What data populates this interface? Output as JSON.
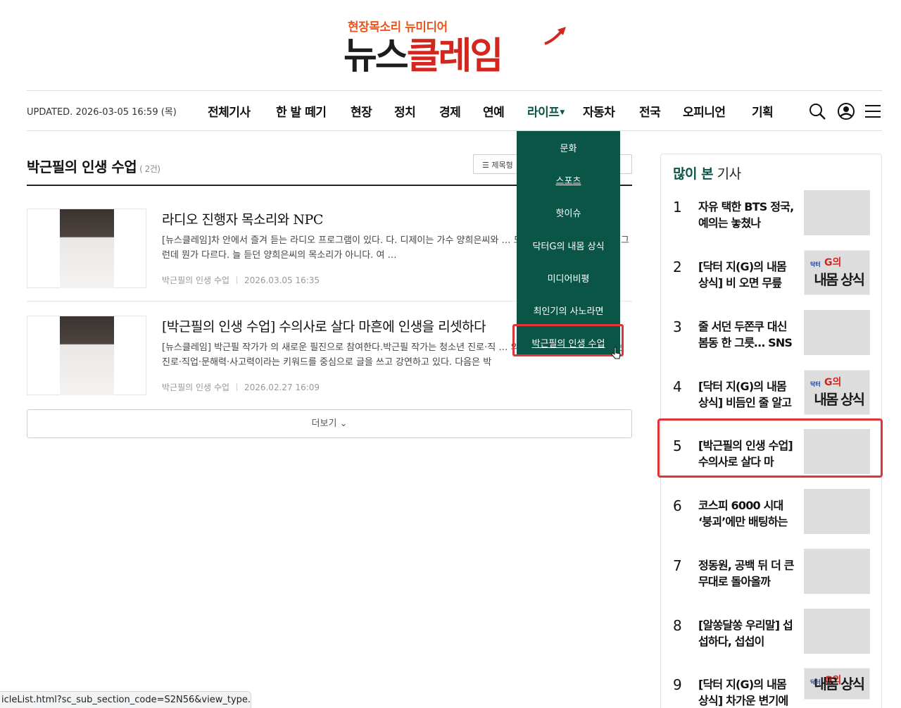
{
  "logo": {
    "tagline": "현장목소리 뉴미디어",
    "name_part1": "뉴스",
    "name_part2": "클레임"
  },
  "header": {
    "updated": "UPDATED. 2026-03-05 16:59 (목)",
    "nav": [
      "전체기사",
      "한 발 떼기",
      "현장",
      "정치",
      "경제",
      "연예",
      "라이프",
      "자동차",
      "전국",
      "오피니언",
      "기획"
    ],
    "icons": [
      "search-icon",
      "user-icon",
      "menu-icon"
    ]
  },
  "dropdown": {
    "items": [
      "문화",
      "스포츠",
      "핫이슈",
      "닥터G의 내몸 상식",
      "미디어비평",
      "최인기의 사노라면",
      "박근필의 인생 수업"
    ]
  },
  "section": {
    "title": "박근필의 인생 수업",
    "count": "( 2건)",
    "view_label": "제목형"
  },
  "articles": [
    {
      "title": "라디오 진행자 목소리와 NPC",
      "summary": "[뉴스클레임]차 안에서 즐겨 듣는 라디오 프로그램이 있다. 다. 디제이는 가수 양희은씨와 … 도 어김없이 라디오를 켰다. 그런데 뭔가 다르다. 늘 듣던 양희은씨의 목소리가 아니다. 여 …",
      "section": "박근필의 인생 수업",
      "date": "2026.03.05 16:35"
    },
    {
      "title": "[박근필의 인생 수업] 수의사로 살다 마흔에 인생을 리셋하다",
      "summary": "[뉴스클레임] 박근필 작가가 의 새로운 필진으로 참여한다.박근필 작가는 청소년 진로·직 … 의 저서를 출간했고, 최근에는 진로·직업·문해력·사고력이라는 키워드를 중심으로 글을 쓰고 강연하고 있다. 다음은 박",
      "section": "박근필의 인생 수업",
      "date": "2026.02.27 16:09"
    }
  ],
  "more": "더보기",
  "popular": {
    "title_hl": "많이 본",
    "title_rest": "기사",
    "items": [
      {
        "num": "1",
        "text": "자유 택한 BTS 정국, 예의는 놓쳤나",
        "thumb": "person"
      },
      {
        "num": "2",
        "text": "[닥터 지(G)의 내몸 상식] 비 오면 무릎",
        "thumb": "comic"
      },
      {
        "num": "3",
        "text": "줄 서던 두쫀쿠 대신 봄동 한 그릇… SNS",
        "thumb": "food"
      },
      {
        "num": "4",
        "text": "[닥터 지(G)의 내몸 상식] 비듬인 줄 알고",
        "thumb": "comic"
      },
      {
        "num": "5",
        "text": "[박근필의 인생 수업] 수의사로 살다 마",
        "thumb": "doctor"
      },
      {
        "num": "6",
        "text": "코스피 6000 시대 ‘붕괴’에만 배팅하는",
        "thumb": "market"
      },
      {
        "num": "7",
        "text": "정동원, 공백 뒤 더 큰 무대로 돌아올까",
        "thumb": "man"
      },
      {
        "num": "8",
        "text": "[알쏭달쏭 우리말] 섭섭하다, 섭섭이",
        "thumb": "dark"
      },
      {
        "num": "9",
        "text": "[닥터 지(G)의 내몸 상식] 차가운 변기에",
        "thumb": "comic"
      }
    ],
    "comic_text": {
      "top": "닥터",
      "g": "G의",
      "main": "내몸 상식"
    }
  },
  "status_url": "icleList.html?sc_sub_section_code=S2N56&view_type...",
  "colors": {
    "accent": "#0b5547",
    "brand_red": "#d3261f",
    "tagline": "#e8561c",
    "highlight": "#e03438"
  }
}
